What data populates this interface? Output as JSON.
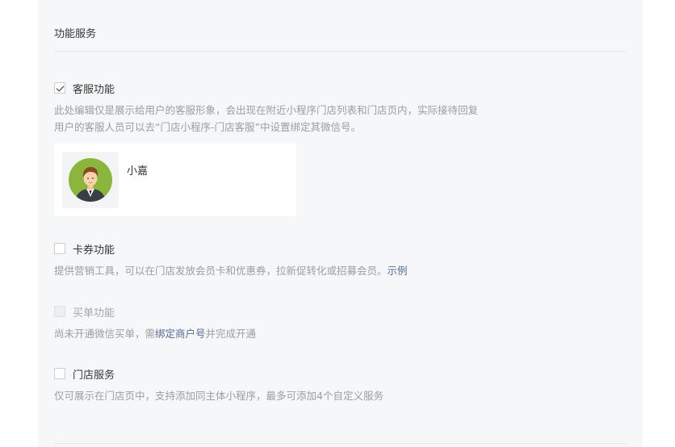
{
  "section": {
    "title": "功能服务"
  },
  "features": {
    "customer_service": {
      "label": "客服功能",
      "checked": true,
      "desc_line1": "此处编辑仅是展示给用户的客服形象，会出现在附近小程序门店列表和门店页内，实际接待回复",
      "desc_line2": "用户的客服人员可以去“门店小程序-门店客服”中设置绑定其微信号。",
      "agent": {
        "name": "小嘉",
        "avatar_icon": "person-avatar-icon"
      }
    },
    "coupon": {
      "label": "卡券功能",
      "checked": false,
      "desc": "提供营销工具，可以在门店发放会员卡和优惠券，拉新促转化或招募会员。",
      "link": "示例"
    },
    "checkout": {
      "label": "买单功能",
      "checked": false,
      "disabled": true,
      "desc_prefix": "尚未开通微信买单，需",
      "desc_link": "绑定商户号",
      "desc_suffix": "并完成开通"
    },
    "store_service": {
      "label": "门店服务",
      "checked": false,
      "desc": "仅可展示在门店页中，支持添加同主体小程序，最多可添加4个自定义服务"
    }
  },
  "colors": {
    "panel_bg": "#f6f7f9",
    "link": "#576b95",
    "muted_text": "#9a9da2",
    "avatar_bg": "#8bb63c"
  }
}
